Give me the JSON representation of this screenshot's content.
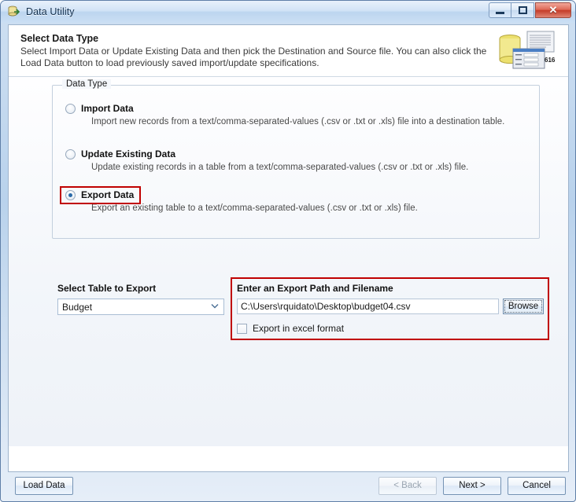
{
  "window": {
    "title": "Data Utility",
    "app_icon": "database-utility-icon",
    "controls": {
      "minimize": "minimize-icon",
      "maximize": "maximize-icon",
      "close": "✕"
    }
  },
  "header": {
    "title": "Select Data Type",
    "description": "Select Import Data or Update Existing Data and then pick the Destination and Source file.  You can also click the Load Data button to load previously saved import/update specifications.",
    "icon": "database-document-form-icon",
    "icon_badge": "616"
  },
  "data_type_group": {
    "legend": "Data Type",
    "options": [
      {
        "label": "Import Data",
        "description": "Import new records from a text/comma-separated-values (.csv or .txt or .xls) file into a destination table.",
        "selected": false,
        "highlighted": false
      },
      {
        "label": "Update Existing Data",
        "description": "Update existing records in a table from a text/comma-separated-values (.csv or .txt or .xls) file.",
        "selected": false,
        "highlighted": false
      },
      {
        "label": "Export Data",
        "description": "Export an existing table to a text/comma-separated-values (.csv or .txt or .xls) file.",
        "selected": true,
        "highlighted": true
      }
    ]
  },
  "table_select": {
    "label": "Select Table to Export",
    "value": "Budget",
    "chevron": "⌄"
  },
  "export_path": {
    "label": "Enter an Export Path and Filename",
    "value": "C:\\Users\\rquidato\\Desktop\\budget04.csv",
    "placeholder": "",
    "browse_label": "Browse",
    "excel_checkbox_label": "Export in excel format",
    "excel_checked": false,
    "highlighted": true
  },
  "footer": {
    "load_data": "Load Data",
    "back": "< Back",
    "back_disabled": true,
    "next": "Next >",
    "cancel": "Cancel"
  },
  "colors": {
    "highlight_red": "#c00000",
    "radio_dot": "#2a6aa8",
    "close_button": "#c43c29"
  }
}
